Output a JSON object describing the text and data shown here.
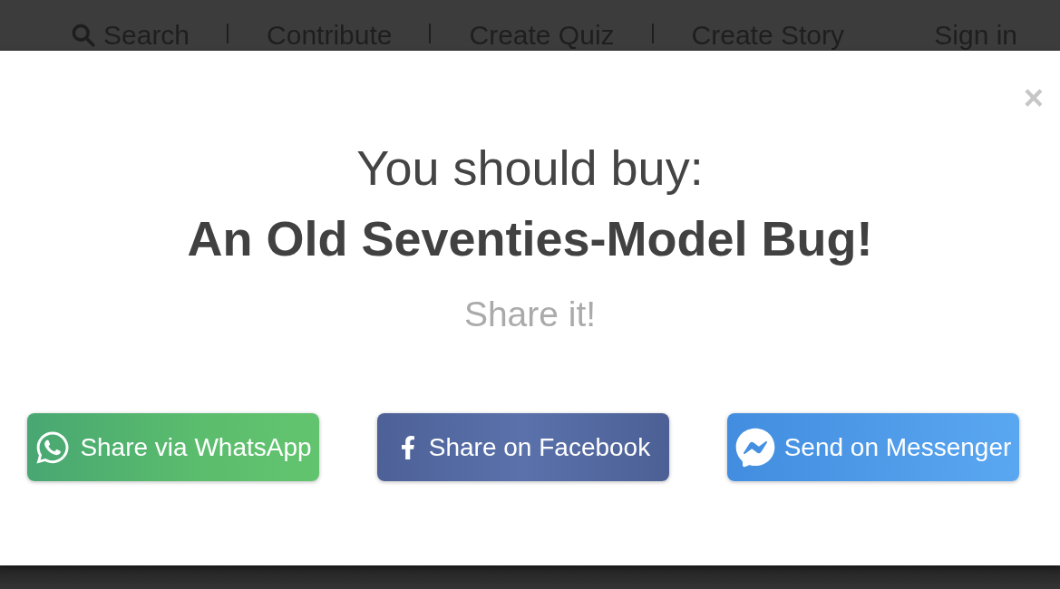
{
  "nav": {
    "search": "Search",
    "links": [
      "Contribute",
      "Create Quiz",
      "Create Story"
    ],
    "sign_in": "Sign in"
  },
  "modal": {
    "close": "×",
    "result_intro": "You should buy:",
    "result": "An Old Seventies-Model Bug!",
    "share_prompt": "Share it!",
    "share_buttons": [
      {
        "kind": "whatsapp",
        "label": "Share via WhatsApp"
      },
      {
        "kind": "facebook",
        "label": "Share on Facebook"
      },
      {
        "kind": "messenger",
        "label": "Send on Messenger"
      }
    ]
  }
}
